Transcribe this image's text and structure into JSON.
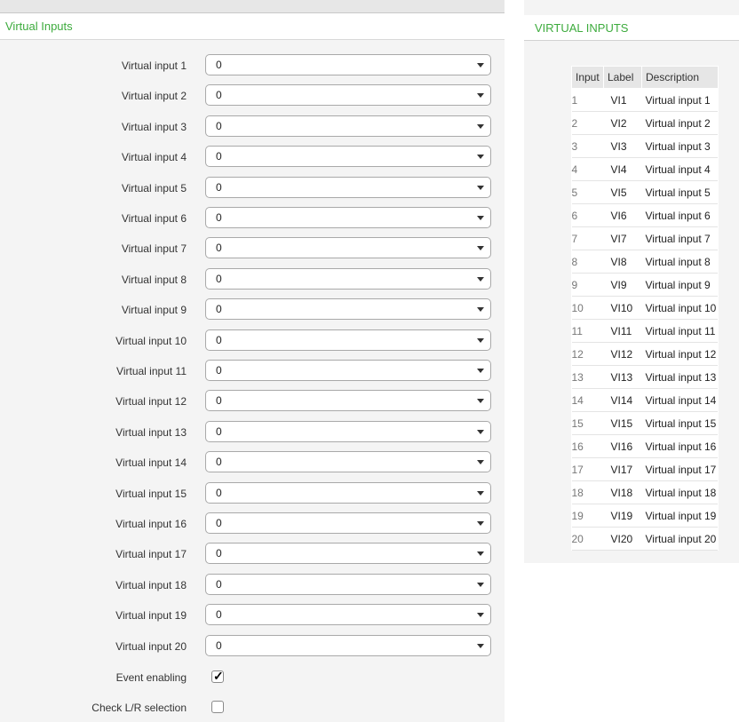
{
  "left_panel": {
    "title": "Virtual Inputs",
    "rows": [
      {
        "label": "Virtual input 1",
        "value": "0"
      },
      {
        "label": "Virtual input 2",
        "value": "0"
      },
      {
        "label": "Virtual input 3",
        "value": "0"
      },
      {
        "label": "Virtual input 4",
        "value": "0"
      },
      {
        "label": "Virtual input 5",
        "value": "0"
      },
      {
        "label": "Virtual input 6",
        "value": "0"
      },
      {
        "label": "Virtual input 7",
        "value": "0"
      },
      {
        "label": "Virtual input 8",
        "value": "0"
      },
      {
        "label": "Virtual input 9",
        "value": "0"
      },
      {
        "label": "Virtual input 10",
        "value": "0"
      },
      {
        "label": "Virtual input 11",
        "value": "0"
      },
      {
        "label": "Virtual input 12",
        "value": "0"
      },
      {
        "label": "Virtual input 13",
        "value": "0"
      },
      {
        "label": "Virtual input 14",
        "value": "0"
      },
      {
        "label": "Virtual input 15",
        "value": "0"
      },
      {
        "label": "Virtual input 16",
        "value": "0"
      },
      {
        "label": "Virtual input 17",
        "value": "0"
      },
      {
        "label": "Virtual input 18",
        "value": "0"
      },
      {
        "label": "Virtual input 19",
        "value": "0"
      },
      {
        "label": "Virtual input 20",
        "value": "0"
      }
    ],
    "event_enabling": {
      "label": "Event enabling",
      "checked": true
    },
    "check_lr": {
      "label": "Check L/R selection",
      "checked": false
    }
  },
  "right_panel": {
    "title": "VIRTUAL INPUTS",
    "headers": [
      "Input",
      "Label",
      "Description"
    ],
    "rows": [
      {
        "input": "1",
        "label": "VI1",
        "description": "Virtual input 1"
      },
      {
        "input": "2",
        "label": "VI2",
        "description": "Virtual input 2"
      },
      {
        "input": "3",
        "label": "VI3",
        "description": "Virtual input 3"
      },
      {
        "input": "4",
        "label": "VI4",
        "description": "Virtual input 4"
      },
      {
        "input": "5",
        "label": "VI5",
        "description": "Virtual input 5"
      },
      {
        "input": "6",
        "label": "VI6",
        "description": "Virtual input 6"
      },
      {
        "input": "7",
        "label": "VI7",
        "description": "Virtual input 7"
      },
      {
        "input": "8",
        "label": "VI8",
        "description": "Virtual input 8"
      },
      {
        "input": "9",
        "label": "VI9",
        "description": "Virtual input 9"
      },
      {
        "input": "10",
        "label": "VI10",
        "description": "Virtual input 10"
      },
      {
        "input": "11",
        "label": "VI11",
        "description": "Virtual input 11"
      },
      {
        "input": "12",
        "label": "VI12",
        "description": "Virtual input 12"
      },
      {
        "input": "13",
        "label": "VI13",
        "description": "Virtual input 13"
      },
      {
        "input": "14",
        "label": "VI14",
        "description": "Virtual input 14"
      },
      {
        "input": "15",
        "label": "VI15",
        "description": "Virtual input 15"
      },
      {
        "input": "16",
        "label": "VI16",
        "description": "Virtual input 16"
      },
      {
        "input": "17",
        "label": "VI17",
        "description": "Virtual input 17"
      },
      {
        "input": "18",
        "label": "VI18",
        "description": "Virtual input 18"
      },
      {
        "input": "19",
        "label": "VI19",
        "description": "Virtual input 19"
      },
      {
        "input": "20",
        "label": "VI20",
        "description": "Virtual input 20"
      }
    ]
  },
  "colors": {
    "accent_green": "#3dab3d",
    "panel_bg": "#f4f4f4"
  },
  "icons": {
    "dropdown": "chevron-down-icon",
    "check": "checkmark-icon"
  }
}
